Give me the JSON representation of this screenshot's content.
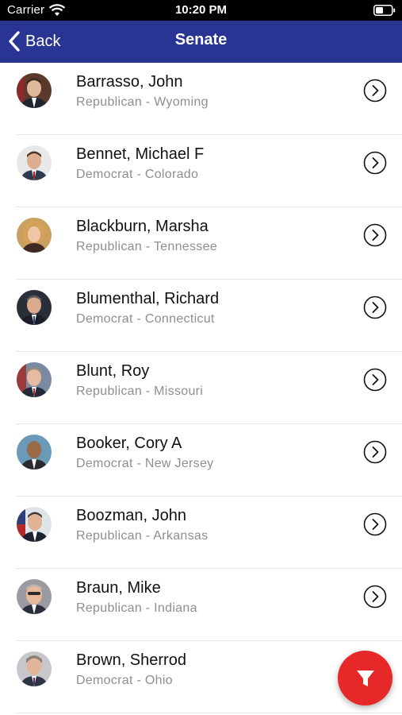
{
  "status_bar": {
    "carrier": "Carrier",
    "time": "10:20 PM",
    "wifi_icon": "wifi-icon",
    "battery_icon": "battery-icon"
  },
  "nav": {
    "back_label": "Back",
    "title": "Senate",
    "background_color": "#283593"
  },
  "senators": [
    {
      "name": "Barrasso, John",
      "subtitle": "Republican - Wyoming",
      "party": "Republican",
      "state": "Wyoming"
    },
    {
      "name": "Bennet, Michael F",
      "subtitle": "Democrat - Colorado",
      "party": "Democrat",
      "state": "Colorado"
    },
    {
      "name": "Blackburn, Marsha",
      "subtitle": "Republican - Tennessee",
      "party": "Republican",
      "state": "Tennessee"
    },
    {
      "name": "Blumenthal, Richard",
      "subtitle": "Democrat - Connecticut",
      "party": "Democrat",
      "state": "Connecticut"
    },
    {
      "name": "Blunt, Roy",
      "subtitle": "Republican - Missouri",
      "party": "Republican",
      "state": "Missouri"
    },
    {
      "name": "Booker, Cory A",
      "subtitle": "Democrat - New Jersey",
      "party": "Democrat",
      "state": "New Jersey"
    },
    {
      "name": "Boozman, John",
      "subtitle": "Republican - Arkansas",
      "party": "Republican",
      "state": "Arkansas"
    },
    {
      "name": "Braun, Mike",
      "subtitle": "Republican - Indiana",
      "party": "Republican",
      "state": "Indiana"
    },
    {
      "name": "Brown, Sherrod",
      "subtitle": "Democrat - Ohio",
      "party": "Democrat",
      "state": "Ohio"
    }
  ],
  "row_icons": {
    "avatar": "senator-portrait",
    "disclosure": "chevron-right-circle-icon"
  },
  "filter_button": {
    "icon": "filter-icon",
    "color": "#e62828"
  }
}
